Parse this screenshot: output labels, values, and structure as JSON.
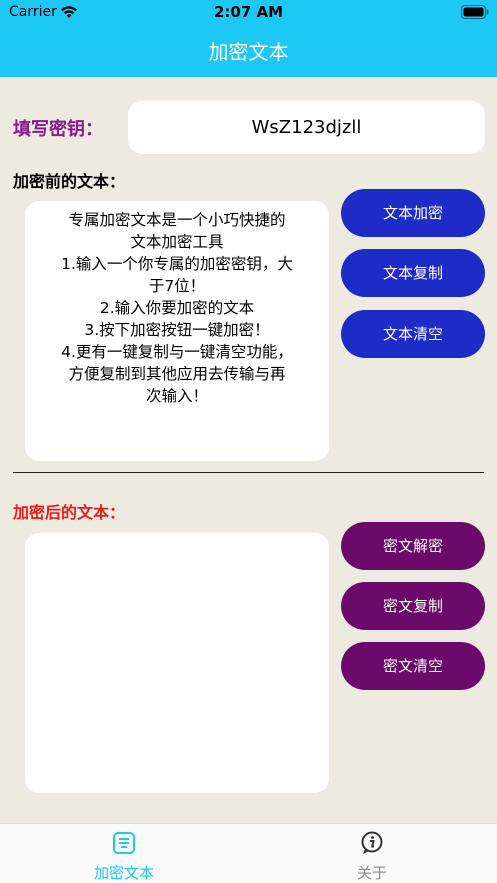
{
  "status_bar": {
    "carrier": "Carrier",
    "time": "2:07 AM"
  },
  "nav": {
    "title": "加密文本"
  },
  "key": {
    "label": "填写密钥：",
    "value": "WsZ123djzll"
  },
  "before": {
    "label": "加密前的文本：",
    "lines": [
      "专属加密文本是一个小巧快捷的",
      "文本加密工具",
      "1.输入一个你专属的加密密钥，大",
      "于7位！",
      "2.输入你要加密的文本",
      "3.按下加密按钮一键加密！",
      "4.更有一键复制与一键清空功能，",
      "方便复制到其他应用去传输与再",
      "次输入！"
    ],
    "buttons": {
      "encrypt": "文本加密",
      "copy": "文本复制",
      "clear": "文本清空"
    }
  },
  "after": {
    "label": "加密后的文本：",
    "buttons": {
      "decrypt": "密文解密",
      "copy": "密文复制",
      "clear": "密文清空"
    }
  },
  "tabbar": {
    "tabs": [
      {
        "label": "加密文本",
        "icon": "document-icon",
        "active": true
      },
      {
        "label": "关于",
        "icon": "info-icon",
        "active": false
      }
    ]
  },
  "colors": {
    "header": "#1ec8f5",
    "background": "#edeadf",
    "key_label": "#8c1a8c",
    "after_label": "#e81e1e",
    "blue_button": "#1d2cc7",
    "purple_button": "#6b0a6b",
    "active_tab": "#1ec8f5",
    "inactive_tab": "#8a8a8a"
  }
}
